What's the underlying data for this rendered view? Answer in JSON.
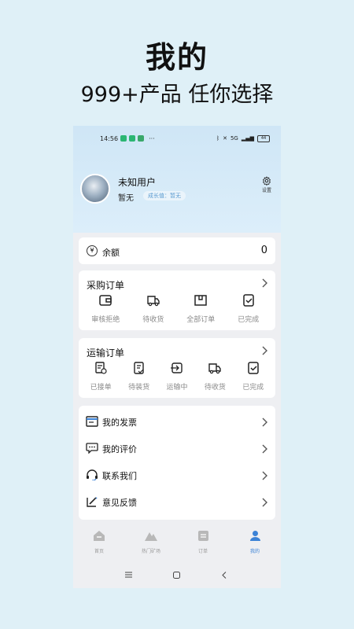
{
  "promo": {
    "title": "我的",
    "subtitle": "999+产品 任你选择"
  },
  "status_bar": {
    "time": "14:56",
    "dots": "···",
    "signal": "5G",
    "battery": "44"
  },
  "profile": {
    "name": "未知用户",
    "info": "暂无",
    "growth": "成长值：暂无",
    "settings_label": "设置"
  },
  "balance": {
    "label": "余额",
    "value": "0",
    "icon": "yen-icon"
  },
  "purchase_orders": {
    "title": "采购订单",
    "items": [
      {
        "label": "审核拒绝",
        "icon": "wallet-icon"
      },
      {
        "label": "待收货",
        "icon": "truck-icon"
      },
      {
        "label": "全部订单",
        "icon": "box-icon"
      },
      {
        "label": "已完成",
        "icon": "check-doc-icon"
      }
    ]
  },
  "transport_orders": {
    "title": "运输订单",
    "items": [
      {
        "label": "已接单",
        "icon": "receipt-clock-icon"
      },
      {
        "label": "待装货",
        "icon": "edit-doc-icon"
      },
      {
        "label": "运输中",
        "icon": "transit-icon"
      },
      {
        "label": "待收货",
        "icon": "truck-icon"
      },
      {
        "label": "已完成",
        "icon": "check-doc-icon"
      }
    ]
  },
  "menu": [
    {
      "label": "我的发票",
      "icon": "invoice-icon"
    },
    {
      "label": "我的评价",
      "icon": "comment-icon"
    },
    {
      "label": "联系我们",
      "icon": "headset-icon"
    },
    {
      "label": "意见反馈",
      "icon": "feedback-icon"
    }
  ],
  "tabs": [
    {
      "label": "首页",
      "icon": "home-icon"
    },
    {
      "label": "热门矿场",
      "icon": "mountain-icon"
    },
    {
      "label": "订单",
      "icon": "order-icon"
    },
    {
      "label": "我的",
      "icon": "user-icon"
    }
  ],
  "colors": {
    "accent": "#3b82d6",
    "header_bg": "#cfe6f6",
    "page_bg": "#dff0f7"
  }
}
